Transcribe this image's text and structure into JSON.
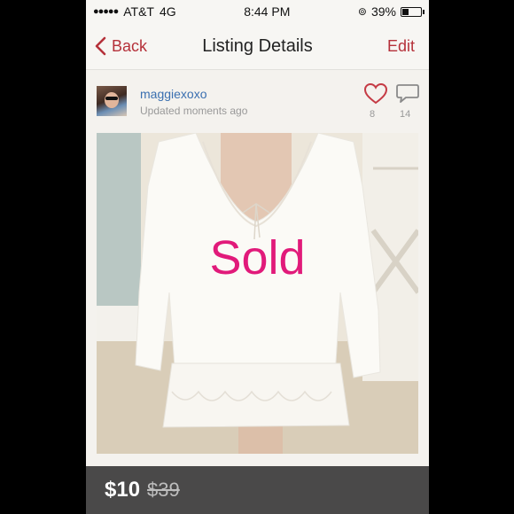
{
  "status_bar": {
    "carrier": "AT&T",
    "network": "4G",
    "time": "8:44 PM",
    "battery": "39%",
    "battery_level": 0.39
  },
  "nav": {
    "back_label": "Back",
    "title": "Listing Details",
    "edit_label": "Edit"
  },
  "listing": {
    "username": "maggiexoxo",
    "updated": "Updated moments ago",
    "likes": "8",
    "comments": "14",
    "sold_label": "Sold",
    "price": "$10",
    "original_price": "$39"
  },
  "colors": {
    "accent": "#b5313a",
    "sold": "#e11a7a"
  }
}
